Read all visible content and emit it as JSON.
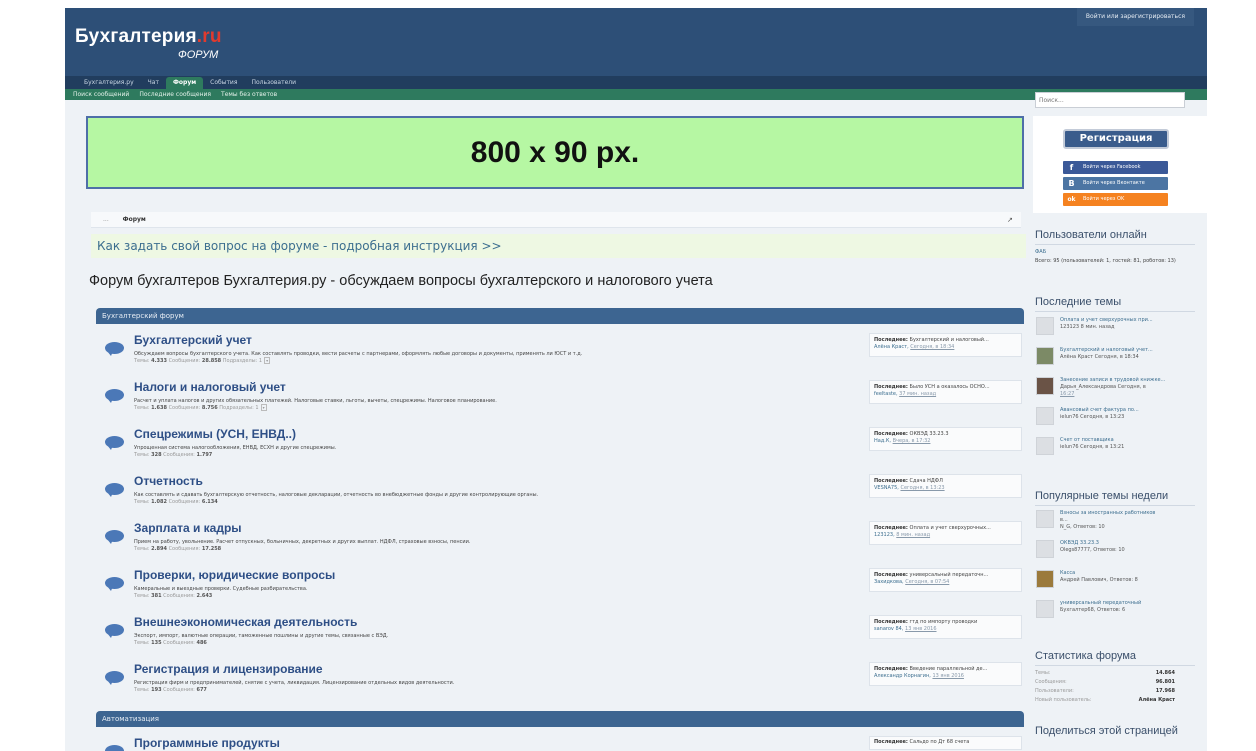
{
  "header": {
    "logo_main": "Бухгалтерия",
    "logo_ru": ".ru",
    "logo_sub": "ФОРУМ",
    "login_link": "Войти или зарегистрироваться"
  },
  "nav": {
    "tabs": [
      "Бухгалтерия.ру",
      "Чат",
      "Форум",
      "События",
      "Пользователи"
    ],
    "active_tab": "Форум",
    "subnav": [
      "Поиск сообщений",
      "Последние сообщения",
      "Темы без ответов"
    ]
  },
  "banner": {
    "text": "800 x 90 px."
  },
  "breadcrumb": {
    "home": "...",
    "current": "Форум"
  },
  "howto": "Как задать свой вопрос на форуме - подробная инструкция >>",
  "forum_title": "Форум бухгалтеров Бухгалтерия.ру - обсуждаем вопросы бухгалтерского и налогового учета",
  "categories": [
    {
      "label": "Бухгалтерский форум"
    },
    {
      "label": "Автоматизация"
    }
  ],
  "nodes": [
    {
      "title": "Бухгалтерский учет",
      "desc": "Обсуждаем вопросы бухгалтерского учета. Как составлять проводки, вести расчеты с партнерами, оформлять любые договоры и документы, применять ли ЮСТ и т.д.",
      "stats_threads_label": "Темы:",
      "threads": "4.333",
      "stats_posts_label": "Сообщения:",
      "posts": "28.858",
      "sub_label": "Подразделы: 1",
      "last_label": "Последнее:",
      "last_topic": "Бухгалтерский и налоговый...",
      "last_user": "Алёна Краст,",
      "last_time": "Сегодня, в 18:34"
    },
    {
      "title": "Налоги и налоговый учет",
      "desc": "Расчет и уплата налогов и других обязательных платежей. Налоговые ставки, льготы, вычеты, спецрежимы. Налоговое планирование.",
      "stats_threads_label": "Темы:",
      "threads": "1.638",
      "stats_posts_label": "Сообщения:",
      "posts": "8.756",
      "sub_label": "Подразделы: 1",
      "last_label": "Последнее:",
      "last_topic": "Было УСН а оказалось ОСНО...",
      "last_user": "feeltaste,",
      "last_time": "37 мин. назад"
    },
    {
      "title": "Спецрежимы (УСН, ЕНВД..)",
      "desc": "Упрощенная система налогообложения, ЕНВД, ЕСХН и другие спецрежимы.",
      "stats_threads_label": "Темы:",
      "threads": "328",
      "stats_posts_label": "Сообщения:",
      "posts": "1.797",
      "sub_label": "",
      "last_label": "Последнее:",
      "last_topic": "ОКВЭД 33.23.3",
      "last_user": "Над.К,",
      "last_time": "Вчера, в 17:32"
    },
    {
      "title": "Отчетность",
      "desc": "Как составлять и сдавать бухгалтерскую отчетность, налоговые декларации, отчетность во внебюджетные фонды и другие контролирующие органы.",
      "stats_threads_label": "Темы:",
      "threads": "1.082",
      "stats_posts_label": "Сообщения:",
      "posts": "6.134",
      "sub_label": "",
      "last_label": "Последнее:",
      "last_topic": "Сдача НДФЛ",
      "last_user": "VESNA75,",
      "last_time": "Сегодня, в 13:23"
    },
    {
      "title": "Зарплата и кадры",
      "desc": "Прием на работу, увольнение. Расчет отпускных, больничных, декретных и других выплат. НДФЛ, страховые взносы, пенсии.",
      "stats_threads_label": "Темы:",
      "threads": "2.894",
      "stats_posts_label": "Сообщения:",
      "posts": "17.258",
      "sub_label": "",
      "last_label": "Последнее:",
      "last_topic": "Оплата и учет сверхурочных...",
      "last_user": "123123,",
      "last_time": "8 мин. назад"
    },
    {
      "title": "Проверки, юридические вопросы",
      "desc": "Камеральные и выездные проверки. Судебные разбирательства.",
      "stats_threads_label": "Темы:",
      "threads": "381",
      "stats_posts_label": "Сообщения:",
      "posts": "2.643",
      "sub_label": "",
      "last_label": "Последнее:",
      "last_topic": "универсальный передаточн...",
      "last_user": "Захидкова,",
      "last_time": "Сегодня, в 07:54"
    },
    {
      "title": "Внешнеэкономическая деятельность",
      "desc": "Экспорт, импорт, валютные операции, таможенные пошлины и другие темы, связанные с ВЭД.",
      "stats_threads_label": "Темы:",
      "threads": "135",
      "stats_posts_label": "Сообщения:",
      "posts": "486",
      "sub_label": "",
      "last_label": "Последнее:",
      "last_topic": "гтд по импорту проводки",
      "last_user": "sanarov 84,",
      "last_time": "13 янв 2016"
    },
    {
      "title": "Регистрация и лицензирование",
      "desc": "Регистрация фирм и предпринимателей, снятие с учета, ликвидация. Лицензирование отдельных видов деятельности.",
      "stats_threads_label": "Темы:",
      "threads": "193",
      "stats_posts_label": "Сообщения:",
      "posts": "677",
      "sub_label": "",
      "last_label": "Последнее:",
      "last_topic": "Введение параллельной де...",
      "last_user": "Александр Корнагин,",
      "last_time": "13 янв 2016"
    },
    {
      "title": "Программные продукты",
      "desc": "",
      "stats_threads_label": "",
      "threads": "",
      "stats_posts_label": "",
      "posts": "",
      "sub_label": "",
      "last_label": "Последнее:",
      "last_topic": "Сальдо по Дт 68 счета",
      "last_user": "",
      "last_time": ""
    }
  ],
  "sidebar": {
    "search_placeholder": "Поиск...",
    "register_button": "Регистрация",
    "social": [
      {
        "label": "Войти через Facebook",
        "icon": "f",
        "color": "#3b5998"
      },
      {
        "label": "Войти через Вконтакте",
        "icon": "B",
        "color": "#4c75a3"
      },
      {
        "label": "Войти через OK",
        "icon": "ok",
        "color": "#f58220"
      }
    ],
    "online_title": "Пользователи онлайн",
    "online_user": "ФАБ",
    "online_totals": "Всего: 95 (пользователей: 1, гостей: 81, роботов: 13)",
    "recent_title": "Последние темы",
    "recent": [
      {
        "t1": "Оплата и учет сверхурочных при...",
        "t2": "123123 8 мин. назад",
        "t3": ""
      },
      {
        "t1": "Бухгалтерский и налоговый учет...",
        "t2": "Алёна Краст Сегодня, в 18:34",
        "t3": ""
      },
      {
        "t1": "Занесение записи в трудовой книжке...",
        "t2": "Дарья_Александрова Сегодня, в",
        "t3": "16:27"
      },
      {
        "t1": "Авансовый счет фактура по...",
        "t2": "ielun76 Сегодня, в 13:23",
        "t3": ""
      },
      {
        "t1": "Счет от поставщика",
        "t2": "ielun76 Сегодня, в 13:21",
        "t3": ""
      }
    ],
    "popular_title": "Популярные темы недели",
    "popular": [
      {
        "t1": "Взносы за иностранных работников",
        "t2": "в...",
        "t3": "N_G, Ответов: 10"
      },
      {
        "t1": "ОКВЭД 33.23.3",
        "t2": "Olegs87777, Ответов: 10",
        "t3": ""
      },
      {
        "t1": "Касса",
        "t2": "Андрей Павлович, Ответов: 8",
        "t3": ""
      },
      {
        "t1": "универсальный передаточный",
        "t2": "Бухгалтер68, Ответов: 6",
        "t3": ""
      }
    ],
    "stats_title": "Статистика форума",
    "stats": [
      {
        "label": "Темы:",
        "value": "14.864"
      },
      {
        "label": "Сообщения:",
        "value": "96.801"
      },
      {
        "label": "Пользователи:",
        "value": "17.968"
      },
      {
        "label": "Новый пользователь:",
        "value": "Алёна Краст"
      }
    ],
    "share_title": "Поделиться этой страницей"
  }
}
